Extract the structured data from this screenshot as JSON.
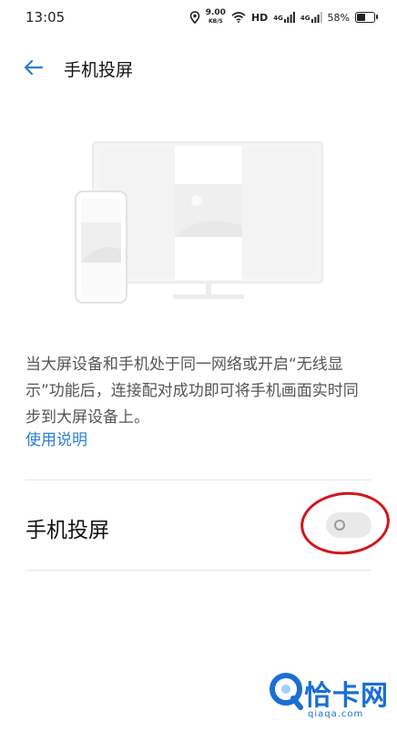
{
  "status_bar": {
    "time": "13:05",
    "net_speed_value": "9.00",
    "net_speed_unit": "KB/S",
    "hd_label": "HD",
    "signal1_label": "4G",
    "signal2_label": "4G",
    "battery_percent": "58%",
    "battery_level": 0.58
  },
  "header": {
    "title": "手机投屏"
  },
  "illustration": {
    "icon": "tv-phone-cast-illustration"
  },
  "description": {
    "text": "当大屏设备和手机处于同一网络或开启“无线显示”功能后，连接配对成功即可将手机画面实时同步到大屏设备上。",
    "help_link": "使用说明"
  },
  "setting": {
    "label": "手机投屏",
    "enabled": false
  },
  "colors": {
    "accent": "#2a7fd4",
    "annotation_red": "#d2161d",
    "toggle_off": "#e9e9e9"
  },
  "watermark": {
    "logo_icon": "qiaqa-logo-icon",
    "text": "恰卡网",
    "subtext": "qiaqa.com"
  }
}
